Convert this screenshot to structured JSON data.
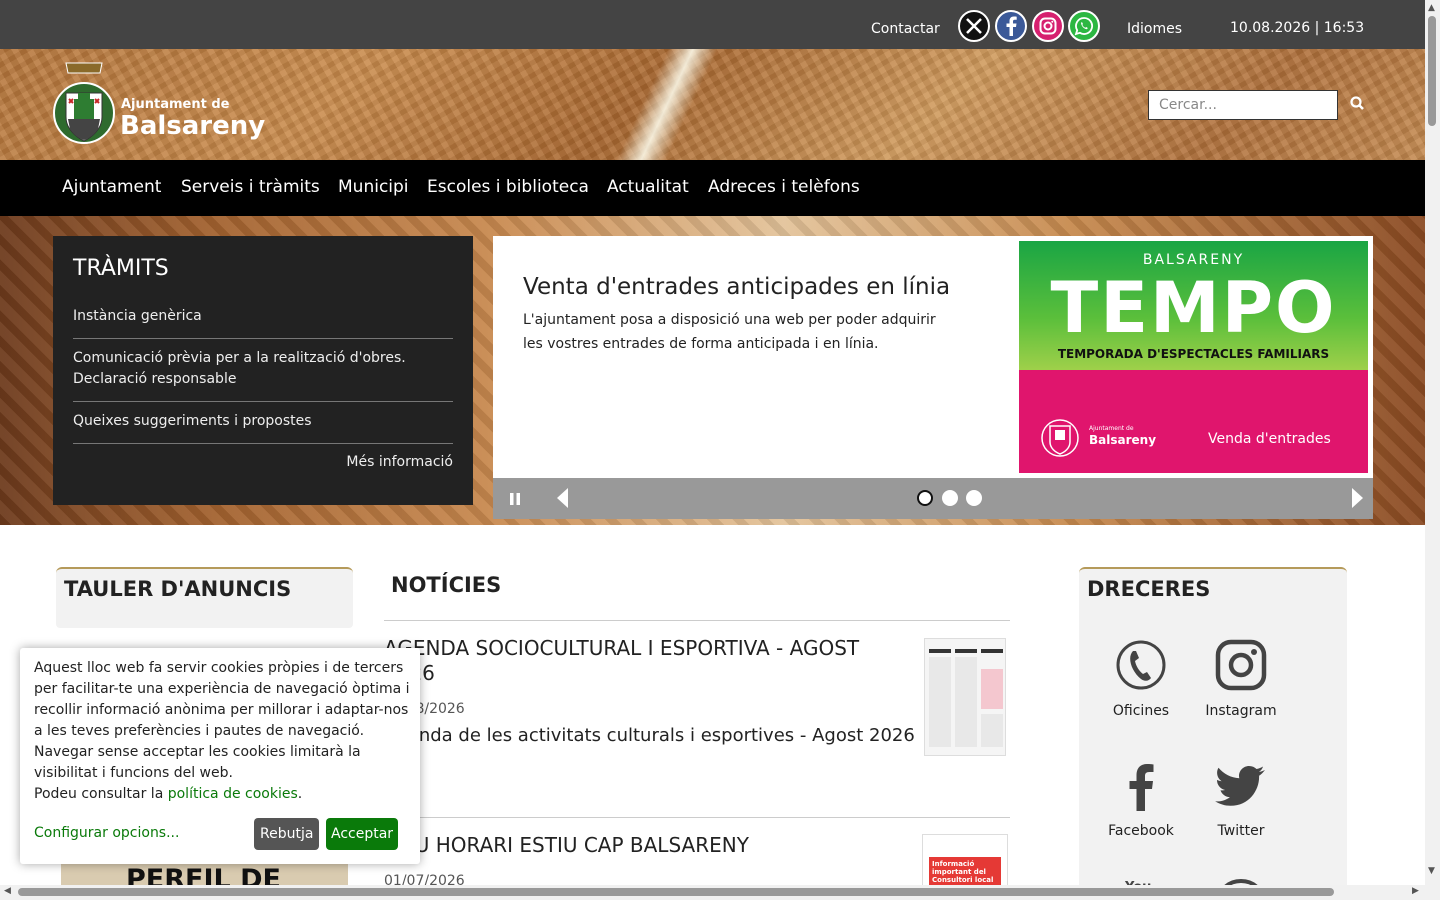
{
  "topbar": {
    "contact": "Contactar",
    "languages": "Idiomes",
    "datetime": "10.08.2026 | 16:53"
  },
  "header": {
    "logo_small": "Ajuntament de",
    "logo_big": "Balsareny",
    "search_placeholder": "Cercar..."
  },
  "nav": {
    "items": [
      "Ajuntament",
      "Serveis i tràmits",
      "Municipi",
      "Escoles i biblioteca",
      "Actualitat",
      "Adreces i telèfons"
    ]
  },
  "tramits": {
    "title": "TRÀMITS",
    "items": [
      "Instància genèrica",
      "Comunicació prèvia per a la realització d'obres. Declaració responsable",
      "Queixes suggeriments i propostes"
    ],
    "more": "Més informació"
  },
  "slide": {
    "title": "Venta d'entrades anticipades en línia",
    "text": "L'ajuntament posa a disposició una web per poder adquirir les vostres entrades de forma anticipada i en línia.",
    "promo": {
      "city": "BALSARENY",
      "brand": "TEMPO",
      "season": "TEMPORADA D'ESPECTACLES FAMILIARS",
      "org_small": "Ajuntament de",
      "org_big": "Balsareny",
      "sale": "Venda d'entrades"
    },
    "total_slides": 3,
    "active_slide": 1
  },
  "tauler": {
    "title": "TAULER D'ANUNCIS",
    "image_text": "PERFIL DE"
  },
  "news": {
    "title": "NOTÍCIES",
    "items": [
      {
        "headline": "AGENDA SOCIOCULTURAL I ESPORTIVA - AGOST 2026",
        "date": "01/08/2026",
        "description": "Agenda de les activitats culturals i esportives - Agost 2026"
      },
      {
        "headline": "NOU HORARI ESTIU CAP BALSARENY",
        "date": "01/07/2026",
        "thumb_text": "Informació important del Consultori local"
      }
    ]
  },
  "dreceres": {
    "title": "DRECERES",
    "items": [
      "Oficines",
      "Instagram",
      "Facebook",
      "Twitter"
    ]
  },
  "cookie": {
    "text": "Aquest lloc web fa servir cookies pròpies i de tercers per facilitar-te una experiència de navegació òptima i recollir informació anònima per millorar i adaptar-nos a les teves preferències i pautes de navegació. Navegar sense acceptar les cookies limitarà la visibilitat i funcions del web.",
    "policy_prefix": "Podeu consultar la",
    "policy_link": "política de cookies",
    "policy_suffix": ".",
    "configure": "Configurar opcions...",
    "reject": "Rebutja",
    "accept": "Acceptar"
  },
  "colors": {
    "topbar": "#444444",
    "nav": "#000000",
    "panel": "#222222",
    "accent_green": "#0a7a0a",
    "tempo_pink": "#e0156d"
  }
}
